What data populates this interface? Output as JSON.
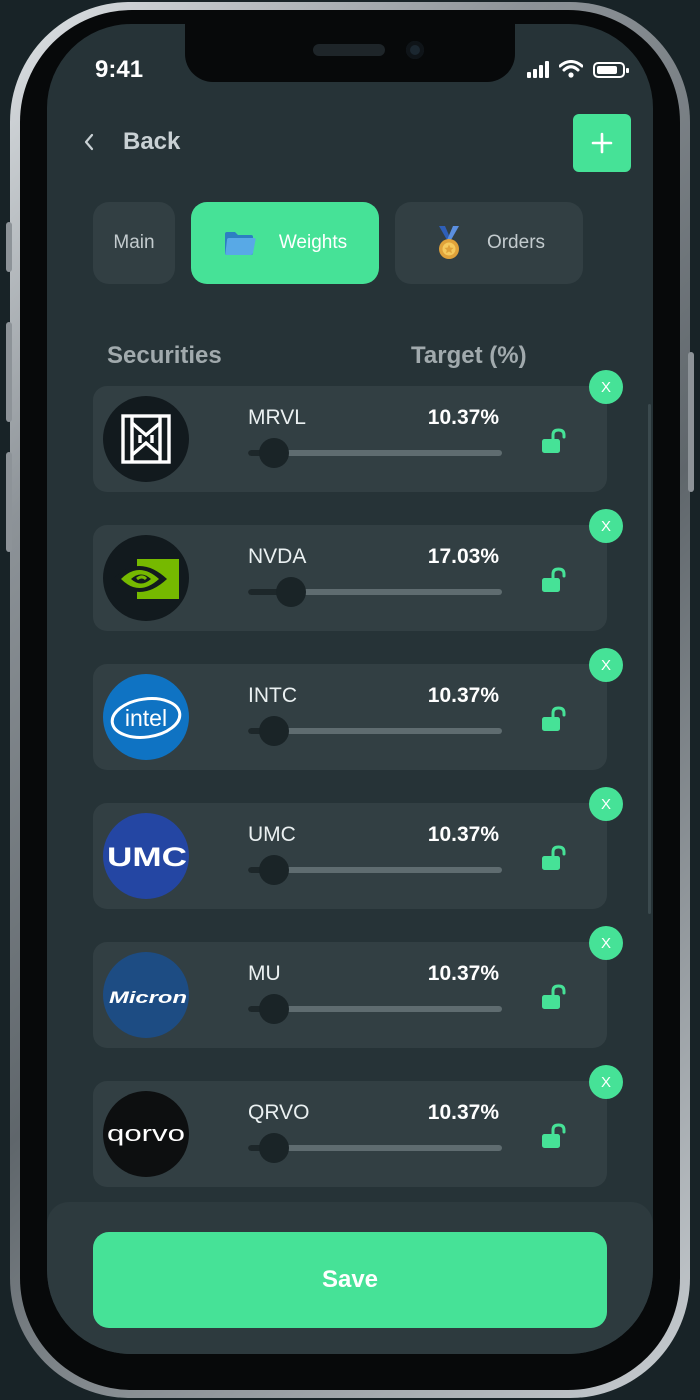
{
  "status_bar": {
    "time": "9:41",
    "battery_level": 0.85
  },
  "nav": {
    "back_label": "Back",
    "add_icon": "plus-icon"
  },
  "tabs": [
    {
      "label": "Main",
      "icon": ""
    },
    {
      "label": "Weights",
      "icon": "folder-icon"
    },
    {
      "label": "Orders",
      "icon": "medal-icon"
    }
  ],
  "active_tab": "Weights",
  "table": {
    "col_securities": "Securities",
    "col_target": "Target (%)"
  },
  "securities": [
    {
      "ticker": "MRVL",
      "target": "10.37%",
      "slider_value": 0.1037,
      "logo": "marvell-logo",
      "logo_bg": "#121a1e",
      "lock_icon": "unlock-icon"
    },
    {
      "ticker": "NVDA",
      "target": "17.03%",
      "slider_value": 0.1703,
      "logo": "nvidia-logo",
      "logo_bg": "#121a1e",
      "lock_icon": "unlock-icon"
    },
    {
      "ticker": "INTC",
      "target": "10.37%",
      "slider_value": 0.1037,
      "logo": "intel-logo",
      "logo_bg": "#0f73c3",
      "logo_text": "intel",
      "lock_icon": "unlock-icon"
    },
    {
      "ticker": "UMC",
      "target": "10.37%",
      "slider_value": 0.1037,
      "logo": "umc-logo",
      "logo_bg": "#2446a3",
      "logo_text": "UMC",
      "lock_icon": "unlock-icon"
    },
    {
      "ticker": "MU",
      "target": "10.37%",
      "slider_value": 0.1037,
      "logo": "micron-logo",
      "logo_bg": "#1d4c83",
      "logo_text": "Micron",
      "lock_icon": "unlock-icon"
    },
    {
      "ticker": "QRVO",
      "target": "10.37%",
      "slider_value": 0.1037,
      "logo": "qorvo-logo",
      "logo_bg": "#0d0f10",
      "logo_text": "qorvo",
      "lock_icon": "unlock-icon"
    }
  ],
  "remove_label": "X",
  "save_label": "Save",
  "colors": {
    "accent": "#46e297",
    "background": "#263337",
    "card": "#323f43"
  }
}
